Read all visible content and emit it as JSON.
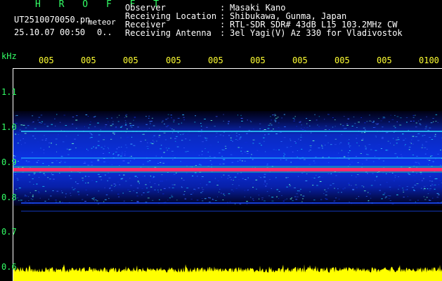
{
  "header": {
    "title": "H R O F F T",
    "filename": "UT2510070050.pn",
    "tag": "meteor",
    "datetime": "25.10.07 00:50",
    "extra": "0..",
    "fields": [
      {
        "label": "Observer",
        "value": "Masaki Kano"
      },
      {
        "label": "Receiving Location",
        "value": "Shibukawa, Gunma, Japan"
      },
      {
        "label": "Receiver",
        "value": "RTL-SDR SDR# 43dB L15 103.2MHz CW"
      },
      {
        "label": "Receiving Antenna",
        "value": "3el Yagi(V) Az 330 for Vladivostok"
      }
    ]
  },
  "spectrogram": {
    "y_unit": "kHz",
    "y_ticks": [
      "1.1",
      "1.0",
      "0.9",
      "0.8",
      "0.7",
      "0.6"
    ],
    "x_ticks": [
      "005",
      "005",
      "005",
      "005",
      "005",
      "005",
      "005",
      "005",
      "005",
      "0100"
    ],
    "colors": {
      "label_green": "#33ff66",
      "label_yellow": "#ffff33",
      "signal_red": "#ff2a6d",
      "noise_blue": "#1a3cff",
      "level_yellow": "#ffff00"
    }
  }
}
